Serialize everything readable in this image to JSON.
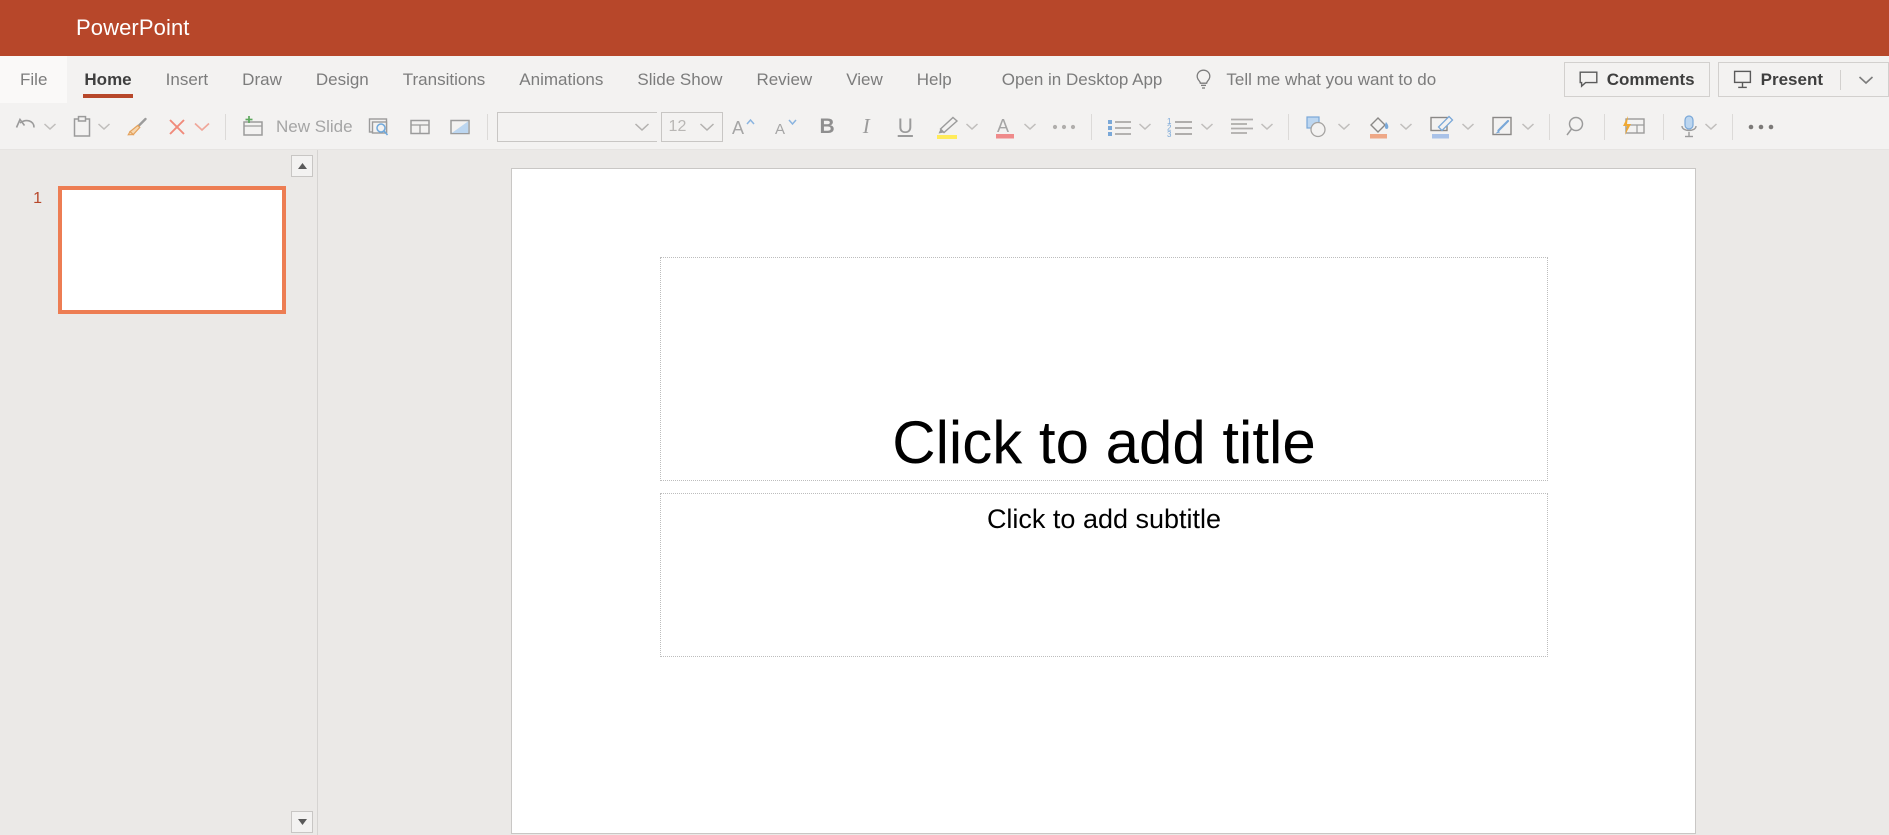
{
  "titlebar": {
    "app_title": "PowerPoint",
    "background": "#b7472a"
  },
  "ribbon": {
    "tabs": [
      {
        "label": "File",
        "active": false
      },
      {
        "label": "Home",
        "active": true
      },
      {
        "label": "Insert",
        "active": false
      },
      {
        "label": "Draw",
        "active": false
      },
      {
        "label": "Design",
        "active": false
      },
      {
        "label": "Transitions",
        "active": false
      },
      {
        "label": "Animations",
        "active": false
      },
      {
        "label": "Slide Show",
        "active": false
      },
      {
        "label": "Review",
        "active": false
      },
      {
        "label": "View",
        "active": false
      },
      {
        "label": "Help",
        "active": false
      }
    ],
    "open_in_desktop_app": "Open in Desktop App",
    "tell_me": "Tell me what you want to do",
    "comments_label": "Comments",
    "present_label": "Present",
    "active_tab_underline_color": "#b7472a"
  },
  "toolbar": {
    "undo_label": "Undo",
    "paste_label": "Paste",
    "format_painter_label": "Format Painter",
    "clear_formatting_label": "Clear All Formatting",
    "new_slide_label": "New Slide",
    "preview_label": "Preview",
    "layout_label": "Layout",
    "reset_label": "Reset",
    "font_name": "",
    "font_name_placeholder": "",
    "font_size": "12",
    "grow_font_label": "Increase Font Size",
    "shrink_font_label": "Decrease Font Size",
    "bold_label": "B",
    "italic_label": "I",
    "underline_label": "U",
    "highlight_label": "Text Highlight Color",
    "font_color_label": "Font Color",
    "more_font_label": "More Font Options",
    "bullets_label": "Bullets",
    "numbering_label": "Numbering",
    "align_label": "Paragraph Alignment",
    "shapes_label": "Shapes",
    "shape_fill_label": "Shape Fill",
    "shape_outline_label": "Shape Outline",
    "shape_effects_label": "Shape Effects",
    "find_label": "Find",
    "designer_label": "Designer",
    "dictate_label": "Dictate",
    "more_label": "More Options",
    "highlight_color": "#ffeb5b",
    "font_color": "#ef8a8a",
    "shape_fill_color": "#eea887",
    "shape_outline_color": "#a9c2e8"
  },
  "thumbnails": {
    "scroll_up_label": "Scroll Up",
    "scroll_down_label": "Scroll Down",
    "slides": [
      {
        "number": "1",
        "selected": true
      }
    ],
    "selection_color": "#ed7d53"
  },
  "slide": {
    "title_placeholder": "Click to add title",
    "subtitle_placeholder": "Click to add subtitle"
  }
}
